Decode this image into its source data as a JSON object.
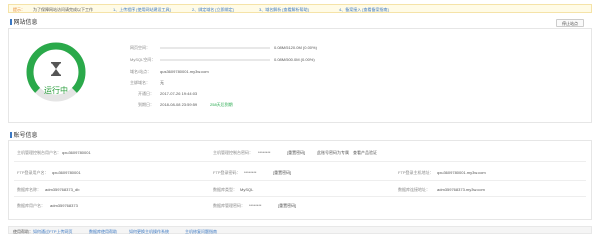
{
  "notice": {
    "tag": "提示：",
    "intro": "为了保障网站访问请完成以下工作",
    "step1": "1、上传程序 [使用网站建设工具]",
    "step2": "2、绑定域名 [立即绑定]",
    "step3": "3、域名解析 [查看解析帮助]",
    "step4": "4、备案接入 [查看备案指南]"
  },
  "site": {
    "title": "网站信息",
    "stop_button": "停止站点",
    "status": "运行中",
    "rows": [
      {
        "label": "网页空间：",
        "value": "0.08M/5120.0M (0.00%)"
      },
      {
        "label": "MySQL空间：",
        "value": "0.08M/500.0M (0.00%)"
      },
      {
        "label": "域名/站点：",
        "value": "qus3609780001.my3w.com"
      },
      {
        "label": "主绑域名：",
        "value": "无"
      },
      {
        "label": "开通日：",
        "value": "2017-07-26 19:44:03"
      },
      {
        "label": "到期日：",
        "value": "2018-08-08 23:59:59",
        "extra": "258天后到期"
      }
    ]
  },
  "account": {
    "title": "账号信息",
    "host_user_label": "主机管理控制台用户名：",
    "host_user_value": "qxu3609780001",
    "host_pwd_label": "主机管理控制台密码：",
    "host_pwd_value": "********",
    "reset1": "[重置密码]",
    "reset_note": "此账号密码为专属",
    "reset_note_link": "查看产品验证",
    "ftp_user_label": "FTP登录用户名：",
    "ftp_user_value": "qxu3609780001",
    "ftp_pwd_label": "FTP登录密码：",
    "ftp_pwd_value": "********",
    "reset2": "[重置密码]",
    "ftp_host_label": "FTP登录主机地址：",
    "ftp_host_value": "qxu3609780001.my3w.com",
    "db_name_label": "数据库名称：",
    "db_name_value": "adm359768373_db",
    "db_type_label": "数据库类型：",
    "db_type_value": "MySQL",
    "db_host_label": "数据库连接地址：",
    "db_host_value": "adm359768373.my3w.com",
    "db_user_label": "数据库用户名：",
    "db_user_value": "adm359768373",
    "db_pwd_label": "数据库管理密码：",
    "db_pwd_value": "********",
    "reset3": "[重置密码]"
  },
  "footer": {
    "label": "使用帮助：",
    "link1": "如何通过FTP上传网页",
    "link2": "数据库使用帮助",
    "link3": "如何更换主机操作系统",
    "link4": "主机修复问题指南"
  }
}
